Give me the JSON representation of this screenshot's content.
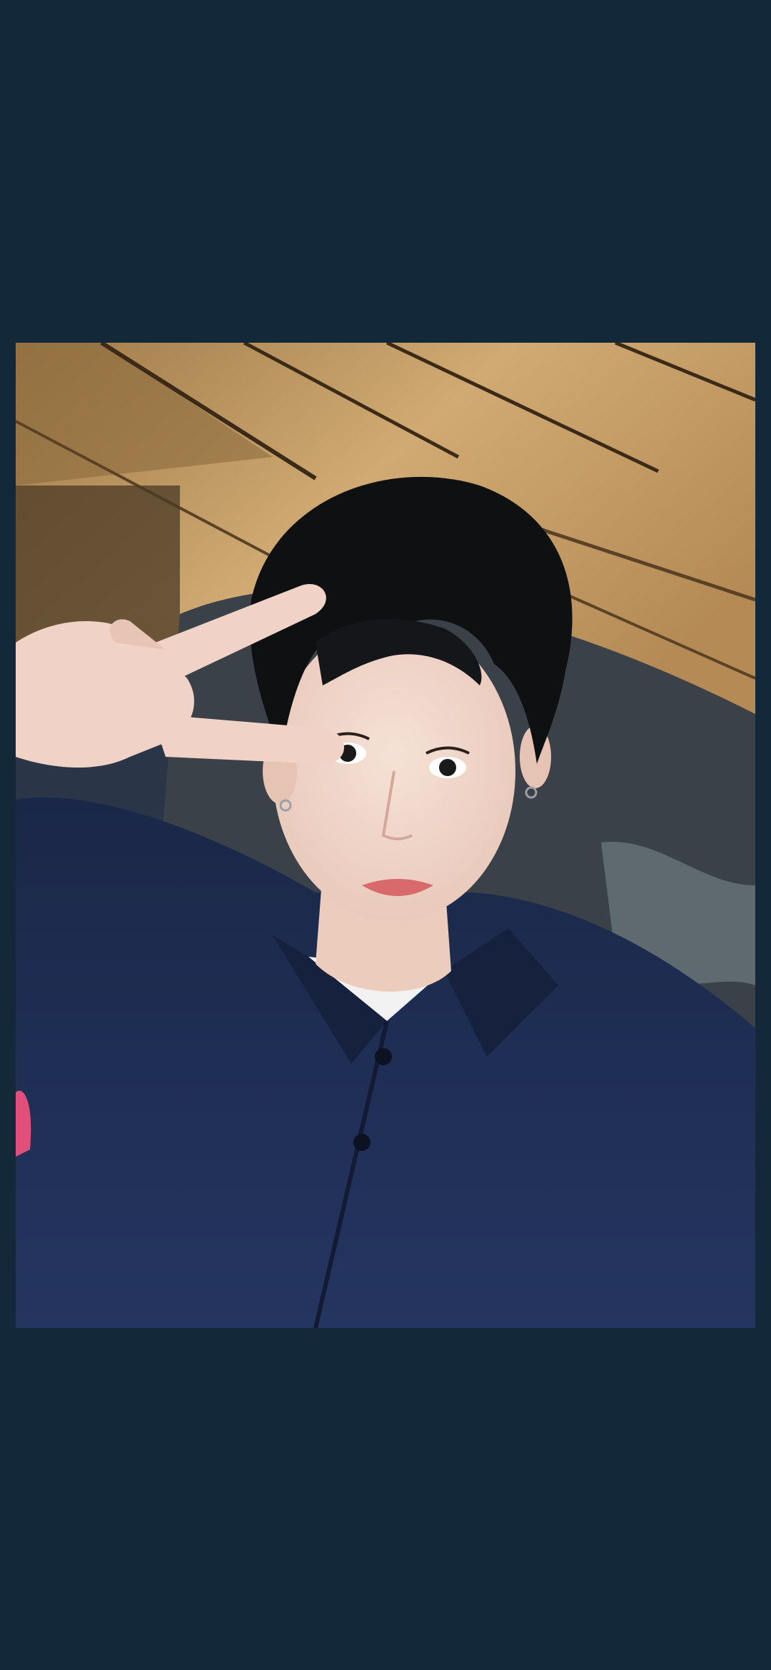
{
  "viewer": {
    "background_color": "#13293a"
  },
  "photo": {
    "subject": "selfie-portrait",
    "palette": {
      "wood_light": "#c9a46c",
      "wood_dark": "#6b5233",
      "seat": "#3a4148",
      "shirt": "#1f2f55",
      "hair": "#0f1012",
      "skin": "#f1d8cc",
      "lips": "#d86a6c",
      "tshirt": "#f2f2f2"
    }
  }
}
